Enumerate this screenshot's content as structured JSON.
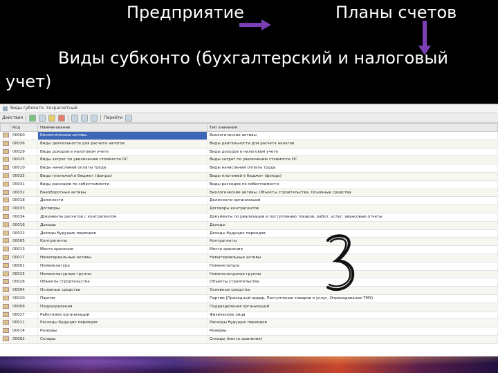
{
  "header": {
    "enterprise": "Предприятие",
    "charts_of_accounts": "Планы счетов",
    "subtitle_line1": "Виды субконто (бухгалтерский и налоговый",
    "subtitle_line2": "учет)"
  },
  "colors": {
    "arrow": "#7a3fb5",
    "selection": "#3c66b8"
  },
  "window": {
    "title": "Виды субконто: Хозрасчетный",
    "toolbar": {
      "actions_label": "Действия",
      "goto_label": "Перейти"
    },
    "columns": {
      "code": "Код",
      "name": "Наименование",
      "type": "Тип значения"
    },
    "rows": [
      {
        "code": "00000",
        "name": "Биологические активы",
        "type": "Биологические активы"
      },
      {
        "code": "00036",
        "name": "Виды деятельности для расчета налогов",
        "type": "Виды деятельности для расчета налогов"
      },
      {
        "code": "00029",
        "name": "Виды доходов в налоговом учете",
        "type": "Виды доходов в налоговом учете"
      },
      {
        "code": "00025",
        "name": "Виды затрат по увеличению стоимости ОС",
        "type": "Виды затрат по увеличению стоимости ОС"
      },
      {
        "code": "00010",
        "name": "Виды начислений оплаты труда",
        "type": "Виды начислений оплаты труда"
      },
      {
        "code": "00035",
        "name": "Виды платежей в бюджет (фонды)",
        "type": "Виды платежей в бюджет (фонды)"
      },
      {
        "code": "00031",
        "name": "Виды расходов по себестоимости",
        "type": "Виды расходов по себестоимости"
      },
      {
        "code": "00032",
        "name": "Внеоборотные активы",
        "type": "Биологические активы, Объекты строительства, Основные средства"
      },
      {
        "code": "00018",
        "name": "Должности",
        "type": "Должности организаций"
      },
      {
        "code": "00033",
        "name": "Договоры",
        "type": "Договоры контрагентов"
      },
      {
        "code": "00034",
        "name": "Документы расчетов с контрагентом",
        "type": "Документы по реализации и поступлению товаров, работ, услуг, авансовые отчеты"
      },
      {
        "code": "00016",
        "name": "Доходы",
        "type": "Доходы"
      },
      {
        "code": "00022",
        "name": "Доходы будущих периодов",
        "type": "Доходы будущих периодов"
      },
      {
        "code": "00005",
        "name": "Контрагенты",
        "type": "Контрагенты"
      },
      {
        "code": "00013",
        "name": "Места хранения",
        "type": "Места хранения"
      },
      {
        "code": "00017",
        "name": "Нематериальные активы",
        "type": "Нематериальные активы"
      },
      {
        "code": "00001",
        "name": "Номенклатура",
        "type": "Номенклатура"
      },
      {
        "code": "00015",
        "name": "Номенклатурные группы",
        "type": "Номенклатурные группы"
      },
      {
        "code": "00026",
        "name": "Объекты строительства",
        "type": "Объекты строительства"
      },
      {
        "code": "00004",
        "name": "Основные средства",
        "type": "Основные средства"
      },
      {
        "code": "00020",
        "name": "Партии",
        "type": "Партии (Приходный ордер, Поступление товаров и услуг, Оприходование ТМЗ)"
      },
      {
        "code": "00008",
        "name": "Подразделения",
        "type": "Подразделения организаций"
      },
      {
        "code": "00027",
        "name": "Работники организаций",
        "type": "Физические лица"
      },
      {
        "code": "00011",
        "name": "Расходы будущих периодов",
        "type": "Расходы будущих периодов"
      },
      {
        "code": "00014",
        "name": "Резервы",
        "type": "Резервы"
      },
      {
        "code": "00002",
        "name": "Склады",
        "type": "Склады (места хранения)"
      }
    ]
  }
}
